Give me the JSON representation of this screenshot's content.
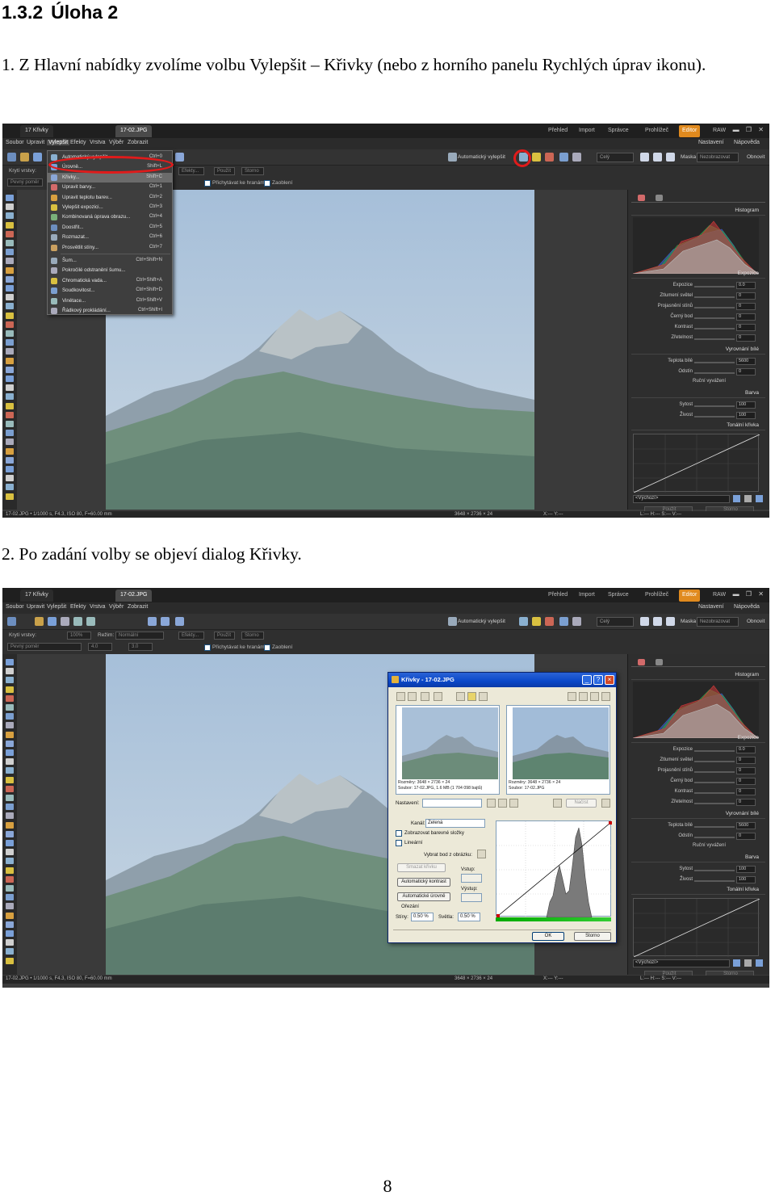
{
  "document": {
    "section_number": "1.3.2",
    "section_title": "Úloha 2",
    "step1": "1. Z Hlavní nabídky zvolíme volbu Vylepšit – Křivky (nebo z horního panelu Rychlých úprav ikonu).",
    "step2": "2. Po zadání volby se objeví dialog Křivky.",
    "page_number": "8"
  },
  "app": {
    "doc_tab_1": "17 Křivky",
    "doc_tab_2": "17-02.JPG",
    "mode_tabs": [
      "Přehled",
      "Import",
      "Správce",
      "Prohlížeč",
      "Editor",
      "RAW"
    ],
    "menu": [
      "Soubor",
      "Upravit",
      "Vylepšit",
      "Efekty",
      "Vrstva",
      "Výběr",
      "Zobrazit"
    ],
    "settings_link": "Nastavení",
    "help_link": "Nápověda",
    "auto_enhance": "Automatický vylepšit",
    "zoom_select": "Celý",
    "mask_label": "Maska",
    "mask_value": "Nezobrazovat",
    "refresh_label": "Obnovit",
    "opt_brush_label": "Krytí vrstvy:",
    "opt_mode_label": "Režim:",
    "opt_mode_value": "Normální",
    "opt_zoom_value": "100%",
    "opt_blend_value": "Efekty...",
    "opt_use": "Použít",
    "opt_cancel": "Storno",
    "opt_ratio": "Pevný poměr",
    "opt_w": "4.0",
    "opt_h": "3.0",
    "opt_snap": "Přichytávat ke hranám",
    "opt_round": "Zaoblení",
    "status_left": "17-02.JPG • 1/1000 s, F4.3, ISO 80, F=60.00 mm",
    "status_mid": "3648 × 2736 × 24",
    "status_xy": "X:--- Y:---",
    "status_right": "L:--- H:--- S:--- V:---"
  },
  "panel": {
    "histogram": "Histogram",
    "exposure_header": "Expozice",
    "rows_exposure": [
      {
        "label": "Expozice",
        "value": "0.0"
      },
      {
        "label": "Ztlumení světel",
        "value": "0"
      },
      {
        "label": "Projasnění stínů",
        "value": "0"
      },
      {
        "label": "Černý bod",
        "value": "0"
      },
      {
        "label": "Kontrast",
        "value": "0"
      },
      {
        "label": "Zřetelnost",
        "value": "0"
      }
    ],
    "wb_header": "Vyrovnání bílé",
    "rows_wb": [
      {
        "label": "Teplota bílé",
        "value": "5600"
      },
      {
        "label": "Odstín",
        "value": "0"
      }
    ],
    "manual_wb": "Ruční vyvážení",
    "color_header": "Barva",
    "rows_color": [
      {
        "label": "Sytost",
        "value": "100"
      },
      {
        "label": "Živost",
        "value": "100"
      }
    ],
    "curve_header": "Tonální křivka",
    "preset": "<Výchozí>",
    "use": "Použít",
    "cancel": "Storno"
  },
  "enhance_menu": [
    {
      "label": "Automatický vylepšit",
      "key": "Ctrl+0"
    },
    {
      "label": "Úrovně...",
      "key": "Shift+L"
    },
    {
      "label": "Křivky...",
      "key": "Shift+C"
    },
    {
      "label": "Upravit barvy...",
      "key": "Ctrl+1"
    },
    {
      "label": "Upravit teplotu barev...",
      "key": "Ctrl+2"
    },
    {
      "label": "Vylepšit expozici...",
      "key": "Ctrl+3"
    },
    {
      "label": "Kombinovaná úprava obrazu...",
      "key": "Ctrl+4"
    },
    {
      "label": "Doostřit...",
      "key": "Ctrl+5"
    },
    {
      "label": "Rozmazat...",
      "key": "Ctrl+6"
    },
    {
      "label": "Prosvětlit stíny...",
      "key": "Ctrl+7"
    },
    {
      "label": "Šum...",
      "key": "Ctrl+Shift+N"
    },
    {
      "label": "Pokročilé odstranění šumu...",
      "key": ""
    },
    {
      "label": "Chromatická vada...",
      "key": "Ctrl+Shift+A"
    },
    {
      "label": "Soudkovitost...",
      "key": "Ctrl+Shift+D"
    },
    {
      "label": "Vinětace...",
      "key": "Ctrl+Shift+V"
    },
    {
      "label": "Řádkový prokládání...",
      "key": "Ctrl+Shift+I"
    }
  ],
  "curves_dialog": {
    "title": "Křivky - 17-02.JPG",
    "left_info_1": "Rozměry: 3648 × 2736 × 24",
    "left_info_2": "Soubor: 17-02.JPG, 1.6 MB (1 704 098 bajtů)",
    "right_info_1": "Rozměry: 3648 × 2736 × 24",
    "right_info_2": "Soubor: 17-02.JPG",
    "settings_label": "Nastavení:",
    "load_btn": "Načíst",
    "channel_label": "Kanál:",
    "channel_value": "Zelená",
    "show_channels": "Zobrazovat barevné složky",
    "linear": "Lineární",
    "pick_point": "Vybrat bod z obrázku:",
    "input_label": "Vstup:",
    "output_label": "Výstup:",
    "reset_curve": "Smazat křivku",
    "auto_contrast": "Automatický kontrast",
    "auto_levels": "Automatické úrovně",
    "clip_label": "Ořezání",
    "shadows_label": "Stíny:",
    "shadows_value": "0.50 %",
    "highlights_label": "Světla:",
    "highlights_value": "0.50 %",
    "ok": "OK",
    "cancel": "Storno"
  },
  "colors": {
    "accent_orange": "#e08a1e",
    "annotation_red": "#e01b1b",
    "dialog_title_blue": "#0a47c8"
  }
}
